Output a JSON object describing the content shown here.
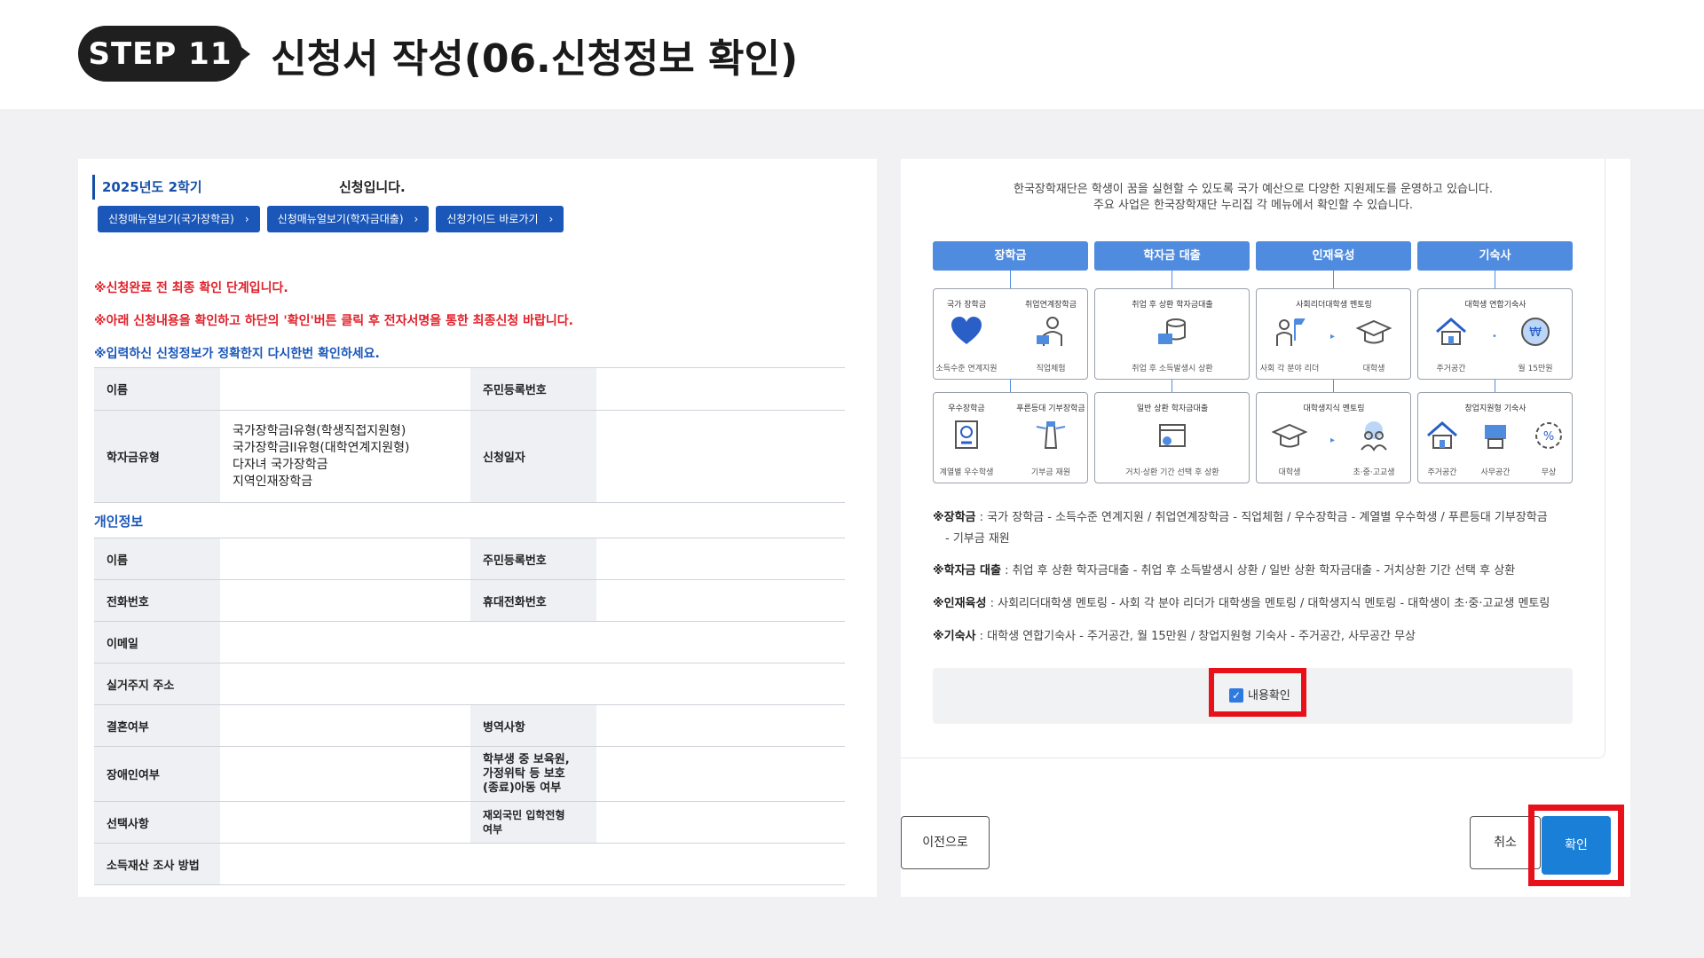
{
  "header": {
    "step": "STEP 11",
    "title": "신청서 작성(06.신청정보 확인)"
  },
  "left": {
    "term": "2025년도 2학기",
    "term_suffix": "신청입니다.",
    "buttons": [
      "신청매뉴얼보기(국가장학금)",
      "신청매뉴얼보기(학자금대출)",
      "신청가이드 바로가기"
    ],
    "notes": [
      "※신청완료 전 최종 확인 단계입니다.",
      "※아래 신청내용을 확인하고 하단의 '확인'버튼 클릭 후 전자서명을 통한 최종신청 바랍니다.",
      "※입력하신 신청정보가 정확한지 다시한번 확인하세요."
    ],
    "table1": {
      "name": "이름",
      "rrn": "주민등록번호",
      "type_label": "학자금유형",
      "types": [
        "국가장학금I유형(학생직접지원형)",
        "국가장학금II유형(대학연계지원형)",
        "다자녀 국가장학금",
        "지역인재장학금"
      ],
      "date_label": "신청일자"
    },
    "section": "개인정보",
    "table2": {
      "name": "이름",
      "rrn": "주민등록번호",
      "phone": "전화번호",
      "mobile": "휴대전화번호",
      "email": "이메일",
      "address": "실거주지 주소",
      "married": "결혼여부",
      "military": "병역사항",
      "disability": "장애인여부",
      "protection_1": "학부생 중 보육원,",
      "protection_2": "가정위탁 등 보호",
      "protection_3": "(종료)아동 여부",
      "optional": "선택사항",
      "overseas_1": "재외국민 입학전형",
      "overseas_2": "여부",
      "income": "소득재산 조사 방법"
    }
  },
  "right": {
    "intro_1": "한국장학재단은 학생이 꿈을 실현할 수 있도록 국가 예산으로 다양한 지원제도를 운영하고 있습니다.",
    "intro_2": "주요 사업은 한국장학재단 누리집 각 메뉴에서 확인할 수 있습니다.",
    "categories": [
      "장학금",
      "학자금 대출",
      "인재육성",
      "기숙사"
    ],
    "cards": {
      "c1a": {
        "t1": "국가 장학금",
        "b1": "소득수준 연계지원",
        "t2": "취업연계장학금",
        "b2": "직업체험"
      },
      "c1b": {
        "t1": "우수장학금",
        "b1": "계열별 우수학생",
        "t2": "푸른등대 기부장학금",
        "b2": "기부금 재원"
      },
      "c2a": {
        "t1": "취업 후 상환 학자금대출",
        "b1": "취업 후 소득발생시 상환"
      },
      "c2b": {
        "t1": "일반 상환 학자금대출",
        "b1": "거치·상환 기간 선택 후 상환"
      },
      "c3a": {
        "t1": "사회리더대학생 멘토링",
        "b1": "사회 각 분야 리더",
        "b2": "대학생"
      },
      "c3b": {
        "t1": "대학생지식 멘토링",
        "b1": "대학생",
        "b2": "초·중·고교생"
      },
      "c4a": {
        "t1": "대학생 연합기숙사",
        "b1": "주거공간",
        "b2": "월 15만원"
      },
      "c4b": {
        "t1": "창업지원형 기숙사",
        "b1": "주거공간",
        "b2": "사무공간",
        "b3": "무상"
      }
    },
    "summary": [
      {
        "k": "※장학금",
        "v": " : 국가 장학금 - 소득수준 연계지원 / 취업연계장학금 - 직업체험 / 우수장학금 - 계열별 우수학생 / 푸른등대 기부장학금"
      },
      {
        "k": "",
        "v": "- 기부금 재원"
      },
      {
        "k": "※학자금 대출",
        "v": " : 취업 후 상환 학자금대출 - 취업 후 소득발생시 상환 / 일반 상환 학자금대출 - 거치상환 기간 선택 후 상환"
      },
      {
        "k": "※인재육성",
        "v": " : 사회리더대학생 멘토링 - 사회 각 분야 리더가 대학생을 멘토링 / 대학생지식 멘토링 - 대학생이 초·중·고교생 멘토링"
      },
      {
        "k": "※기숙사",
        "v": " : 대학생 연합기숙사 - 주거공간, 월 15만원 / 창업지원형 기숙사 - 주거공간, 사무공간 무상"
      }
    ],
    "confirm_label": "내용확인"
  },
  "footer": {
    "prev": "이전으로",
    "cancel": "취소",
    "ok": "확인"
  },
  "colors": {
    "accent_blue": "#1a57b8",
    "category_blue": "#4f8ce0",
    "highlight_red": "#e8111a",
    "notice_red": "#e0202a"
  }
}
